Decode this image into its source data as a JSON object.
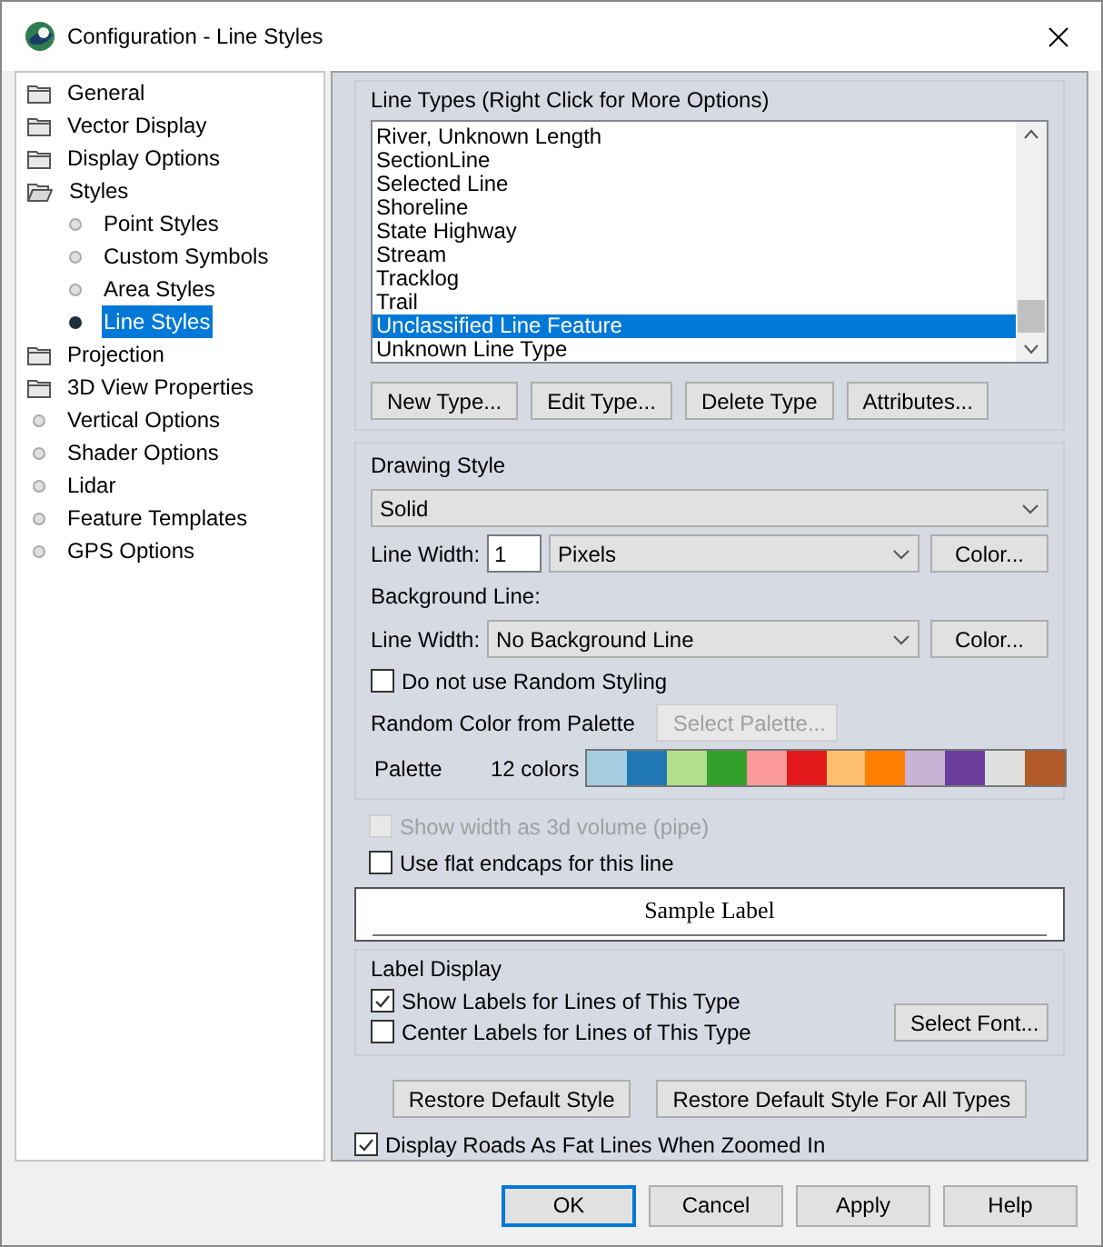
{
  "window": {
    "title": "Configuration - Line Styles"
  },
  "sidebar": {
    "items": [
      {
        "label": "General",
        "kind": "folder",
        "selected": false
      },
      {
        "label": "Vector Display",
        "kind": "folder",
        "selected": false
      },
      {
        "label": "Display Options",
        "kind": "folder",
        "selected": false
      },
      {
        "label": "Styles",
        "kind": "folder-open",
        "selected": false,
        "children": [
          {
            "label": "Point Styles",
            "kind": "dot",
            "selected": false
          },
          {
            "label": "Custom Symbols",
            "kind": "dot",
            "selected": false
          },
          {
            "label": "Area Styles",
            "kind": "dot",
            "selected": false
          },
          {
            "label": "Line Styles",
            "kind": "dot",
            "selected": true
          }
        ]
      },
      {
        "label": "Projection",
        "kind": "folder",
        "selected": false
      },
      {
        "label": "3D View Properties",
        "kind": "folder",
        "selected": false
      },
      {
        "label": "Vertical Options",
        "kind": "dot",
        "selected": false
      },
      {
        "label": "Shader Options",
        "kind": "dot",
        "selected": false
      },
      {
        "label": "Lidar",
        "kind": "dot",
        "selected": false
      },
      {
        "label": "Feature Templates",
        "kind": "dot",
        "selected": false
      },
      {
        "label": "GPS Options",
        "kind": "dot",
        "selected": false
      }
    ]
  },
  "line_types": {
    "title": "Line Types (Right Click for More Options)",
    "items": [
      {
        "label": "River, Unknown Length",
        "selected": false
      },
      {
        "label": "SectionLine",
        "selected": false
      },
      {
        "label": "Selected Line",
        "selected": false
      },
      {
        "label": "Shoreline",
        "selected": false
      },
      {
        "label": "State Highway",
        "selected": false
      },
      {
        "label": "Stream",
        "selected": false
      },
      {
        "label": "Tracklog",
        "selected": false
      },
      {
        "label": "Trail",
        "selected": false
      },
      {
        "label": "Unclassified Line Feature",
        "selected": true
      },
      {
        "label": "Unknown Line Type",
        "selected": false
      }
    ],
    "buttons": [
      "New Type...",
      "Edit Type...",
      "Delete Type",
      "Attributes..."
    ]
  },
  "drawing_style": {
    "title": "Drawing Style",
    "style": "Solid",
    "line_width": {
      "label": "Line Width:",
      "value": "1",
      "unit": "Pixels",
      "color_button": "Color..."
    },
    "background_line": {
      "title": "Background Line:",
      "label": "Line Width:",
      "value": "No Background Line",
      "color_button": "Color..."
    },
    "random_styling": {
      "label": "Do not use Random Styling",
      "checked": false
    },
    "random_palette": {
      "label": "Random Color from Palette",
      "button": "Select Palette...",
      "disabled": true
    },
    "palette": {
      "label": "Palette",
      "count": "12 colors",
      "colors": [
        {
          "color": "#a6cee3"
        },
        {
          "color": "#1f78b4"
        },
        {
          "color": "#b2df8a"
        },
        {
          "color": "#33a02c"
        },
        {
          "color": "#fb9a99"
        },
        {
          "color": "#e31a1c"
        },
        {
          "color": "#fdbf6f"
        },
        {
          "color": "#ff7f00"
        },
        {
          "color": "#cab2d6"
        },
        {
          "color": "#6a3d9a"
        },
        {
          "color": "#e0e0e0"
        },
        {
          "color": "#b15928"
        }
      ]
    }
  },
  "pipe": {
    "label": "Show width as 3d volume (pipe)",
    "checked": false,
    "disabled": true
  },
  "flat_endcaps": {
    "label": "Use flat endcaps for this line",
    "checked": false,
    "disabled": false
  },
  "sample": {
    "label": "Sample Label"
  },
  "label_display": {
    "title": "Label Display",
    "options": [
      {
        "label": "Show Labels for Lines of This Type",
        "checked": true
      },
      {
        "label": "Center Labels for Lines of This Type",
        "checked": false
      }
    ],
    "button": "Select Font..."
  },
  "restore_buttons": [
    "Restore Default Style",
    "Restore Default Style For All Types"
  ],
  "fat_lines": {
    "label": "Display Roads As Fat Lines When Zoomed In",
    "checked": true
  },
  "footer_buttons": [
    {
      "label": "OK",
      "default": true
    },
    {
      "label": "Cancel",
      "default": false
    },
    {
      "label": "Apply",
      "default": false
    },
    {
      "label": "Help",
      "default": false
    }
  ]
}
